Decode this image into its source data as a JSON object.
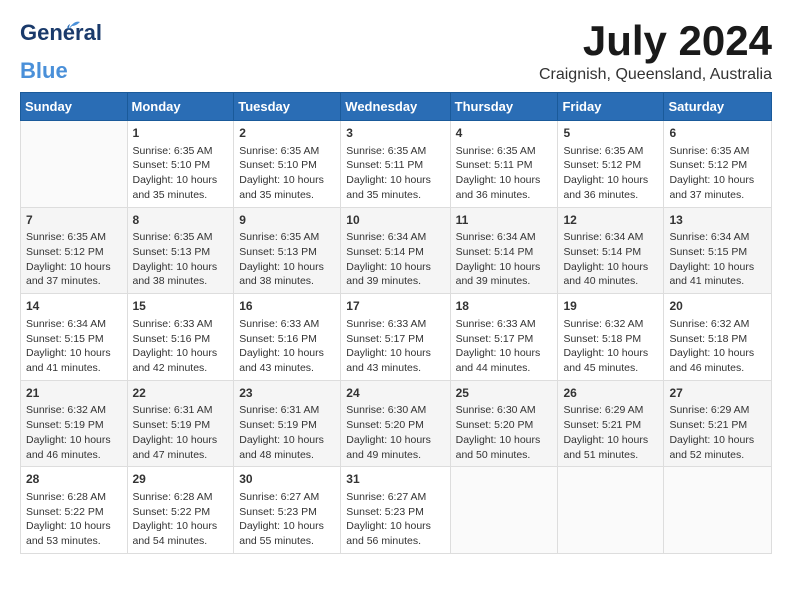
{
  "logo": {
    "general": "General",
    "blue": "Blue"
  },
  "title": {
    "month_year": "July 2024",
    "location": "Craignish, Queensland, Australia"
  },
  "headers": [
    "Sunday",
    "Monday",
    "Tuesday",
    "Wednesday",
    "Thursday",
    "Friday",
    "Saturday"
  ],
  "weeks": [
    [
      {
        "day": "",
        "sunrise": "",
        "sunset": "",
        "daylight": ""
      },
      {
        "day": "1",
        "sunrise": "Sunrise: 6:35 AM",
        "sunset": "Sunset: 5:10 PM",
        "daylight": "Daylight: 10 hours and 35 minutes."
      },
      {
        "day": "2",
        "sunrise": "Sunrise: 6:35 AM",
        "sunset": "Sunset: 5:10 PM",
        "daylight": "Daylight: 10 hours and 35 minutes."
      },
      {
        "day": "3",
        "sunrise": "Sunrise: 6:35 AM",
        "sunset": "Sunset: 5:11 PM",
        "daylight": "Daylight: 10 hours and 35 minutes."
      },
      {
        "day": "4",
        "sunrise": "Sunrise: 6:35 AM",
        "sunset": "Sunset: 5:11 PM",
        "daylight": "Daylight: 10 hours and 36 minutes."
      },
      {
        "day": "5",
        "sunrise": "Sunrise: 6:35 AM",
        "sunset": "Sunset: 5:12 PM",
        "daylight": "Daylight: 10 hours and 36 minutes."
      },
      {
        "day": "6",
        "sunrise": "Sunrise: 6:35 AM",
        "sunset": "Sunset: 5:12 PM",
        "daylight": "Daylight: 10 hours and 37 minutes."
      }
    ],
    [
      {
        "day": "7",
        "sunrise": "Sunrise: 6:35 AM",
        "sunset": "Sunset: 5:12 PM",
        "daylight": "Daylight: 10 hours and 37 minutes."
      },
      {
        "day": "8",
        "sunrise": "Sunrise: 6:35 AM",
        "sunset": "Sunset: 5:13 PM",
        "daylight": "Daylight: 10 hours and 38 minutes."
      },
      {
        "day": "9",
        "sunrise": "Sunrise: 6:35 AM",
        "sunset": "Sunset: 5:13 PM",
        "daylight": "Daylight: 10 hours and 38 minutes."
      },
      {
        "day": "10",
        "sunrise": "Sunrise: 6:34 AM",
        "sunset": "Sunset: 5:14 PM",
        "daylight": "Daylight: 10 hours and 39 minutes."
      },
      {
        "day": "11",
        "sunrise": "Sunrise: 6:34 AM",
        "sunset": "Sunset: 5:14 PM",
        "daylight": "Daylight: 10 hours and 39 minutes."
      },
      {
        "day": "12",
        "sunrise": "Sunrise: 6:34 AM",
        "sunset": "Sunset: 5:14 PM",
        "daylight": "Daylight: 10 hours and 40 minutes."
      },
      {
        "day": "13",
        "sunrise": "Sunrise: 6:34 AM",
        "sunset": "Sunset: 5:15 PM",
        "daylight": "Daylight: 10 hours and 41 minutes."
      }
    ],
    [
      {
        "day": "14",
        "sunrise": "Sunrise: 6:34 AM",
        "sunset": "Sunset: 5:15 PM",
        "daylight": "Daylight: 10 hours and 41 minutes."
      },
      {
        "day": "15",
        "sunrise": "Sunrise: 6:33 AM",
        "sunset": "Sunset: 5:16 PM",
        "daylight": "Daylight: 10 hours and 42 minutes."
      },
      {
        "day": "16",
        "sunrise": "Sunrise: 6:33 AM",
        "sunset": "Sunset: 5:16 PM",
        "daylight": "Daylight: 10 hours and 43 minutes."
      },
      {
        "day": "17",
        "sunrise": "Sunrise: 6:33 AM",
        "sunset": "Sunset: 5:17 PM",
        "daylight": "Daylight: 10 hours and 43 minutes."
      },
      {
        "day": "18",
        "sunrise": "Sunrise: 6:33 AM",
        "sunset": "Sunset: 5:17 PM",
        "daylight": "Daylight: 10 hours and 44 minutes."
      },
      {
        "day": "19",
        "sunrise": "Sunrise: 6:32 AM",
        "sunset": "Sunset: 5:18 PM",
        "daylight": "Daylight: 10 hours and 45 minutes."
      },
      {
        "day": "20",
        "sunrise": "Sunrise: 6:32 AM",
        "sunset": "Sunset: 5:18 PM",
        "daylight": "Daylight: 10 hours and 46 minutes."
      }
    ],
    [
      {
        "day": "21",
        "sunrise": "Sunrise: 6:32 AM",
        "sunset": "Sunset: 5:19 PM",
        "daylight": "Daylight: 10 hours and 46 minutes."
      },
      {
        "day": "22",
        "sunrise": "Sunrise: 6:31 AM",
        "sunset": "Sunset: 5:19 PM",
        "daylight": "Daylight: 10 hours and 47 minutes."
      },
      {
        "day": "23",
        "sunrise": "Sunrise: 6:31 AM",
        "sunset": "Sunset: 5:19 PM",
        "daylight": "Daylight: 10 hours and 48 minutes."
      },
      {
        "day": "24",
        "sunrise": "Sunrise: 6:30 AM",
        "sunset": "Sunset: 5:20 PM",
        "daylight": "Daylight: 10 hours and 49 minutes."
      },
      {
        "day": "25",
        "sunrise": "Sunrise: 6:30 AM",
        "sunset": "Sunset: 5:20 PM",
        "daylight": "Daylight: 10 hours and 50 minutes."
      },
      {
        "day": "26",
        "sunrise": "Sunrise: 6:29 AM",
        "sunset": "Sunset: 5:21 PM",
        "daylight": "Daylight: 10 hours and 51 minutes."
      },
      {
        "day": "27",
        "sunrise": "Sunrise: 6:29 AM",
        "sunset": "Sunset: 5:21 PM",
        "daylight": "Daylight: 10 hours and 52 minutes."
      }
    ],
    [
      {
        "day": "28",
        "sunrise": "Sunrise: 6:28 AM",
        "sunset": "Sunset: 5:22 PM",
        "daylight": "Daylight: 10 hours and 53 minutes."
      },
      {
        "day": "29",
        "sunrise": "Sunrise: 6:28 AM",
        "sunset": "Sunset: 5:22 PM",
        "daylight": "Daylight: 10 hours and 54 minutes."
      },
      {
        "day": "30",
        "sunrise": "Sunrise: 6:27 AM",
        "sunset": "Sunset: 5:23 PM",
        "daylight": "Daylight: 10 hours and 55 minutes."
      },
      {
        "day": "31",
        "sunrise": "Sunrise: 6:27 AM",
        "sunset": "Sunset: 5:23 PM",
        "daylight": "Daylight: 10 hours and 56 minutes."
      },
      {
        "day": "",
        "sunrise": "",
        "sunset": "",
        "daylight": ""
      },
      {
        "day": "",
        "sunrise": "",
        "sunset": "",
        "daylight": ""
      },
      {
        "day": "",
        "sunrise": "",
        "sunset": "",
        "daylight": ""
      }
    ]
  ]
}
